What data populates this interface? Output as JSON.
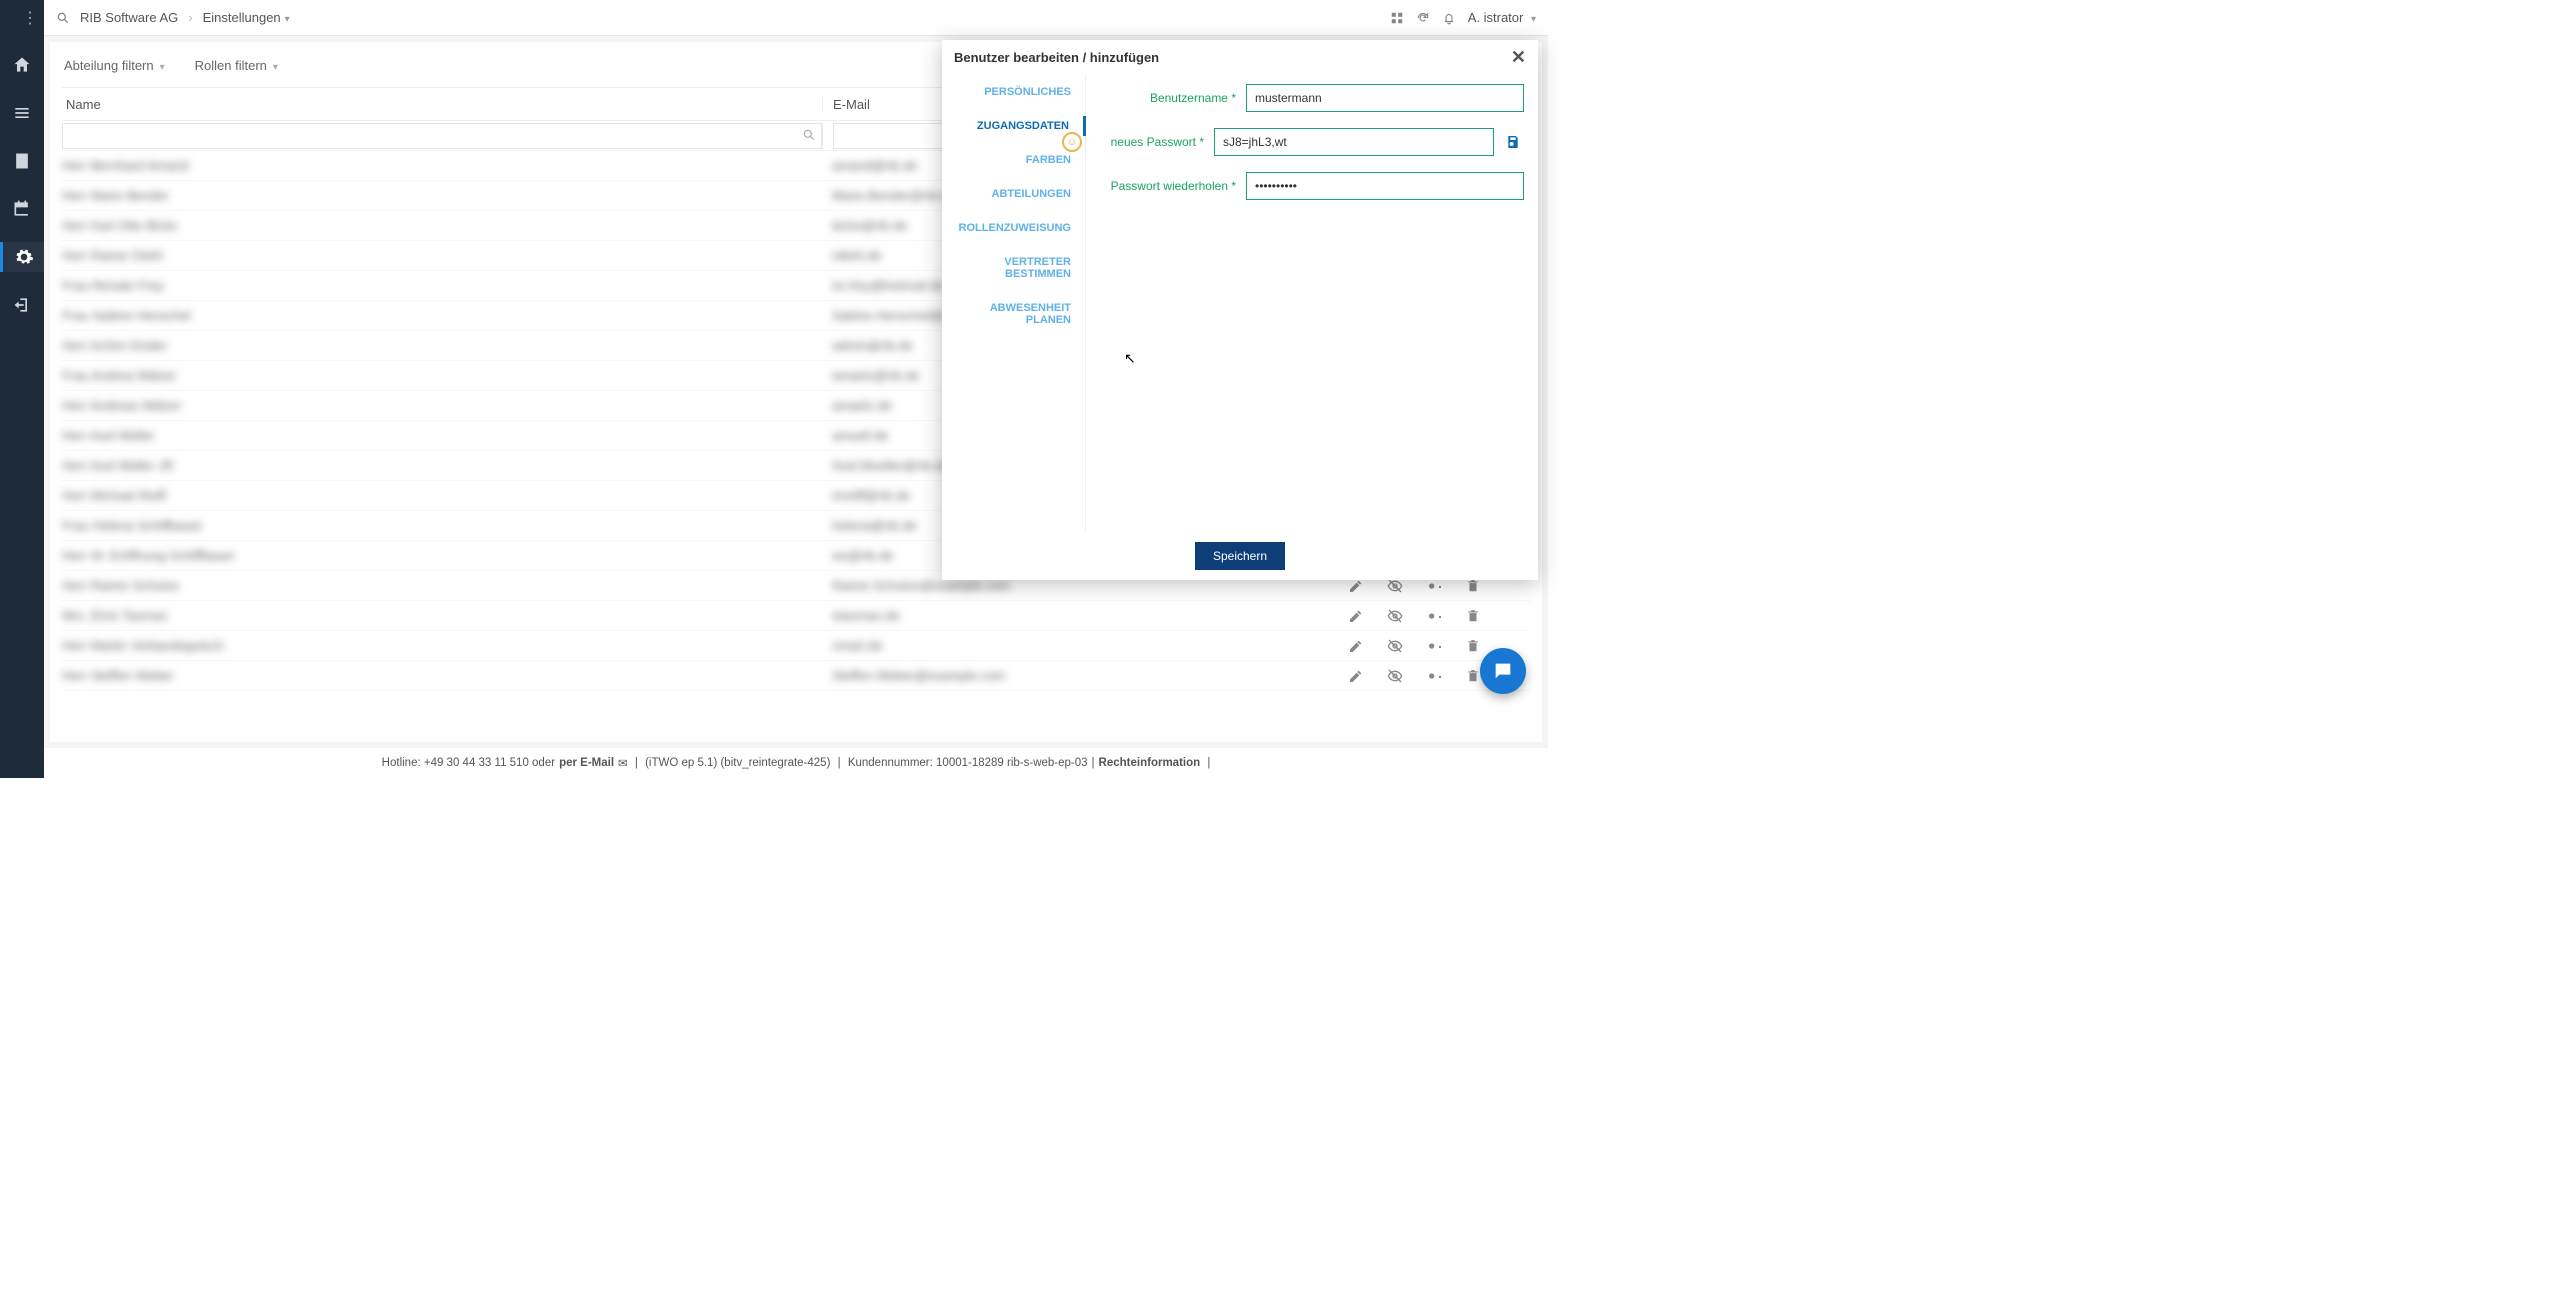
{
  "breadcrumb": {
    "org": "RIB Software AG",
    "page": "Einstellungen"
  },
  "user": {
    "name": "A. istrator"
  },
  "filters": {
    "dept": "Abteilung filtern",
    "role": "Rollen filtern"
  },
  "table": {
    "headers": {
      "name": "Name",
      "email": "E-Mail"
    },
    "rows": [
      {
        "name": "Herr Bernhard Amand",
        "email": "amand@rib.de"
      },
      {
        "name": "Herr Mario Bender",
        "email": "Mario.Bender@rib.de"
      },
      {
        "name": "Herr Karl-Otto Bicks",
        "email": "bicks@rib.de"
      },
      {
        "name": "Herr Rainer Diehl",
        "email": "rdiehl.de"
      },
      {
        "name": "Frau Renate Frey",
        "email": "im.frey@hotmail.de"
      },
      {
        "name": "Frau Sabine Henschel",
        "email": "Sabine.Henschel@rib.de"
      },
      {
        "name": "Herr Achim Kinder",
        "email": "admin@rib.de"
      },
      {
        "name": "Frau Andrea Mälzer",
        "email": "amaelz@rib.de"
      },
      {
        "name": "Herr Andreas Mälzer",
        "email": "amaelz.de"
      },
      {
        "name": "Herr Axel Müller",
        "email": "amuell.de"
      },
      {
        "name": "Herr Axel Müller JR",
        "email": "Axel.Mueller@rib.de"
      },
      {
        "name": "Herr Michael Reiff",
        "email": "mreiff@rib.de"
      },
      {
        "name": "Frau Helena Schiffbauer",
        "email": "helena@rib.de"
      },
      {
        "name": "Herr W. Eröffnung Schiffbauer",
        "email": "ws@rib.de"
      },
      {
        "name": "Herr Rainer Schulze",
        "email": "Rainer.Schulze@example.com"
      },
      {
        "name": "Mrs. Elvis Tasman",
        "email": "etasman.de"
      },
      {
        "name": "Herr Martin Verbandsgutsch",
        "email": "vmart.de"
      },
      {
        "name": "Herr Steffen Weber",
        "email": "Steffen.Weber@example.com"
      }
    ]
  },
  "panel": {
    "title": "Benutzer bearbeiten / hinzufügen",
    "tabs": {
      "personal": "PERSÖNLICHES",
      "access": "ZUGANGSDATEN",
      "colors": "FARBEN",
      "departments": "ABTEILUNGEN",
      "roles": "ROLLENZUWEISUNG",
      "deputy": "VERTRETER BESTIMMEN",
      "absence": "ABWESENHEIT PLANEN"
    },
    "form": {
      "username_label": "Benutzername *",
      "username_value": "mustermann",
      "newpwd_label": "neues Passwort *",
      "newpwd_value": "sJ8=jhL3,wt",
      "repeatpwd_label": "Passwort wiederholen *",
      "repeatpwd_value": "••••••••••"
    },
    "save": "Speichern"
  },
  "footer": {
    "hotline_pre": "Hotline: +49 30 44 33 11 510 oder ",
    "hotline_mail": "per E-Mail",
    "version": "(iTWO ep 5.1) (bitv_reintegrate-425)",
    "customer": "Kundennummer: 10001-18289 rib-s-web-ep-03",
    "legal": "Rechteinformation"
  }
}
